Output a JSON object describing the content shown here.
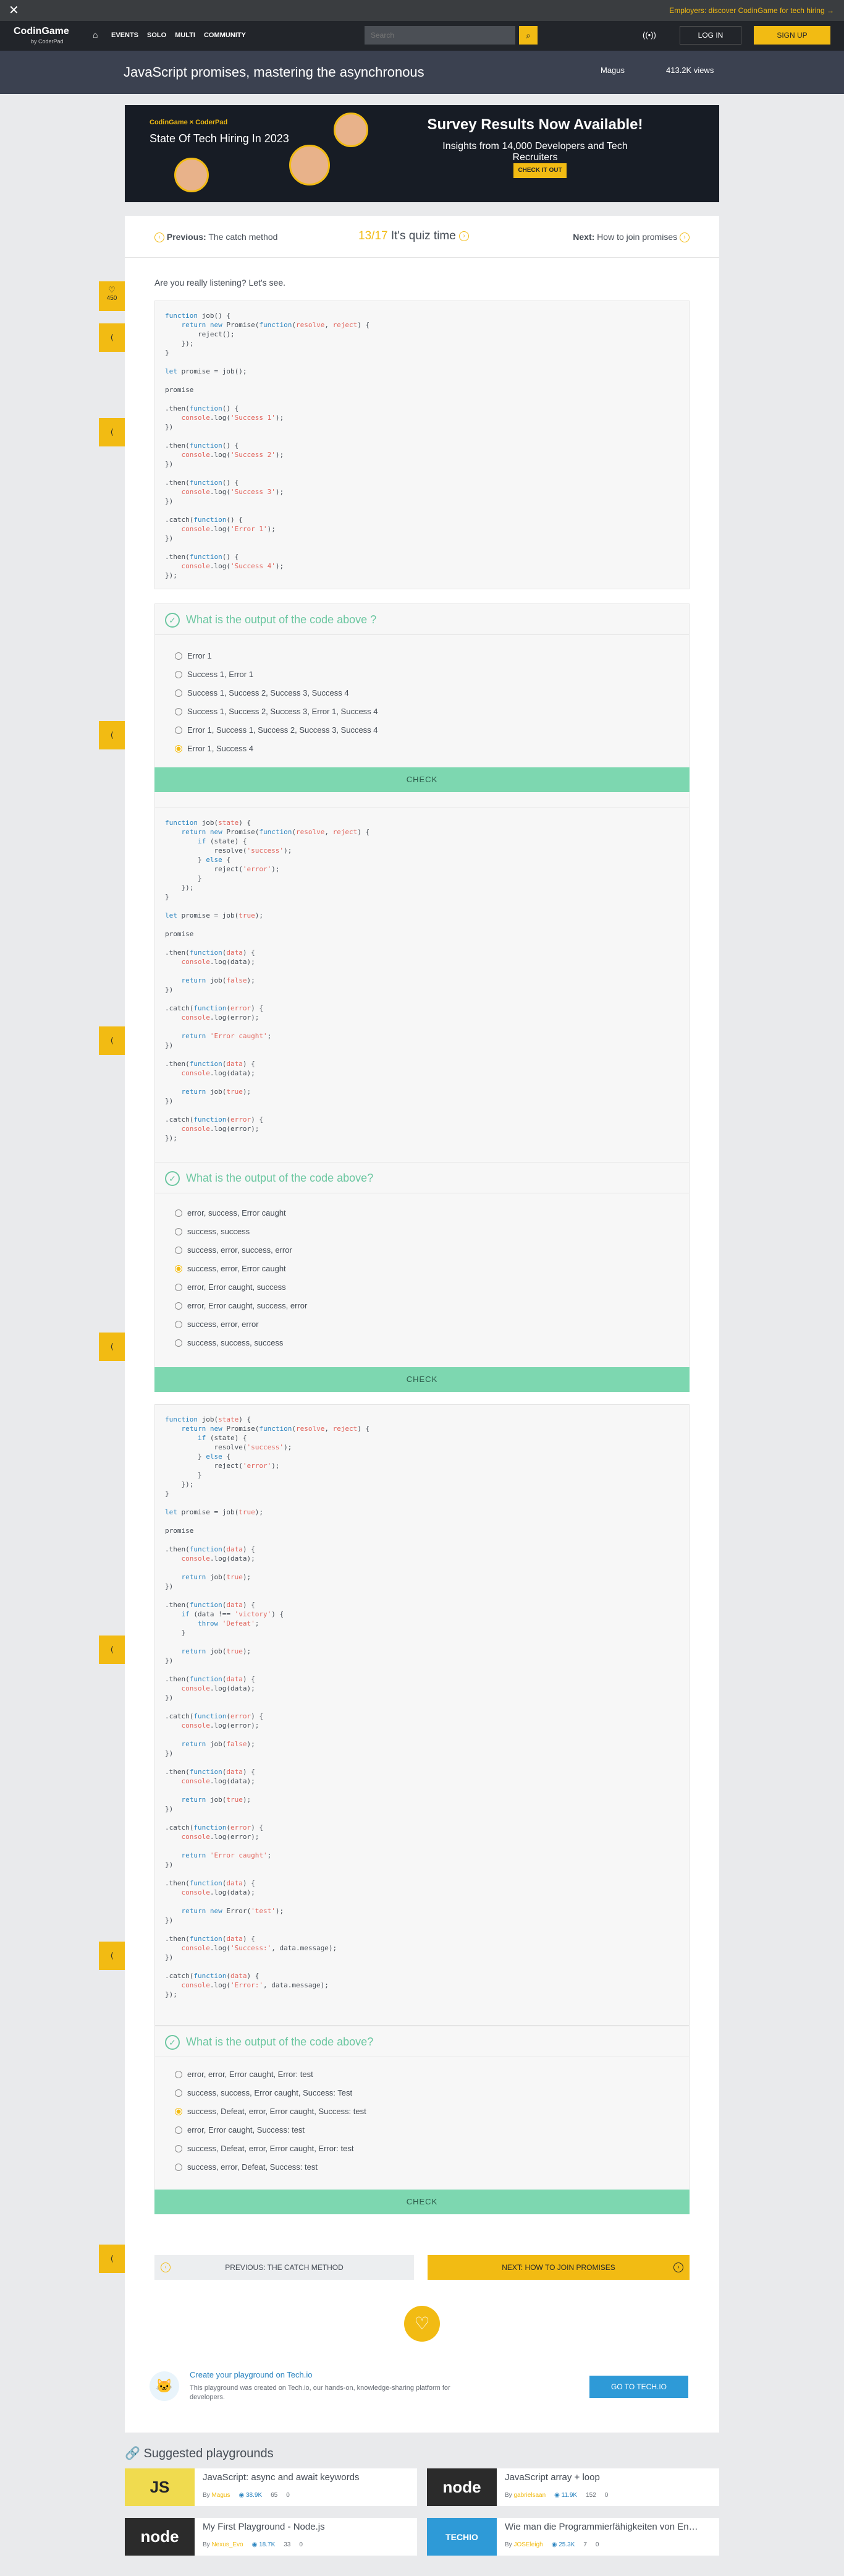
{
  "topbar": {
    "close": "✕",
    "promo": "Employers: discover CodinGame for tech hiring →"
  },
  "nav": {
    "logo": "CodinGame",
    "logo_by": "by CoderPad",
    "home": "⌂",
    "menu": [
      "EVENTS",
      "SOLO",
      "MULTI",
      "COMMUNITY"
    ],
    "search_placeholder": "Search",
    "search_icon": "⌕",
    "live_icon": "((•))",
    "login": "LOG IN",
    "signup": "SIGN UP"
  },
  "page_header": {
    "title": "JavaScript promises, mastering the asynchronous",
    "author": "Magus",
    "views": "413.2K views"
  },
  "banner": {
    "brand": "CodinGame × CoderPad",
    "sot": "State Of Tech Hiring In 2023",
    "headline": "Survey Results Now Available!",
    "subline": "Insights from 14,000 Developers and Tech Recruiters",
    "cta": "CHECK IT OUT"
  },
  "pager": {
    "prev_label": "Previous:",
    "prev_title": "The catch method",
    "current": "13/17",
    "current_title": "It's quiz time",
    "next_label": "Next:",
    "next_title": "How to join promises"
  },
  "sidebar": {
    "likes": "450",
    "heart_icon": "♡",
    "share_icon": "⟨"
  },
  "intro": "Are you really listening? Let's see.",
  "quizzes": [
    {
      "question": "What is the output of the code above ?",
      "options": [
        "Error 1",
        "Success 1, Error 1",
        "Success 1, Success 2, Success 3, Success 4",
        "Success 1, Success 2, Success 3, Error 1, Success 4",
        "Error 1, Success 1, Success 2, Success 3, Success 4",
        "Error 1, Success 4"
      ],
      "selected": 5,
      "check": "CHECK"
    },
    {
      "question": "What is the output of the code above?",
      "options": [
        "error, success, Error caught",
        "success, success",
        "success, error, success, error",
        "success, error, Error caught",
        "error, Error caught, success",
        "error, Error caught, success, error",
        "success, error, error",
        "success, success, success"
      ],
      "selected": 3,
      "check": "CHECK"
    },
    {
      "question": "What is the output of the code above?",
      "options": [
        "error, error, Error caught, Error: test",
        "success, success, Error caught, Success: Test",
        "success, Defeat, error, Error caught, Success: test",
        "error, Error caught, Success: test",
        "success, Defeat, error, Error caught, Error: test",
        "success, error, Defeat, Success: test"
      ],
      "selected": 2,
      "check": "CHECK"
    }
  ],
  "bottom_nav": {
    "prev": "PREVIOUS: THE CATCH METHOD",
    "next": "NEXT: HOW TO JOIN PROMISES",
    "prev_icon": "‹",
    "next_icon": "›"
  },
  "techio": {
    "title": "Create your playground on Tech.io",
    "desc": "This playground was created on Tech.io, our hands-on, knowledge-sharing platform for developers.",
    "button": "GO TO TECH.IO",
    "cat_icon": "tech-io-cat-icon"
  },
  "suggested": {
    "title": "Suggested playgrounds",
    "cards": [
      {
        "thumb": "JS",
        "title": "JavaScript: async and await keywords",
        "by": "By",
        "author": "Magus",
        "views": "38.9K",
        "likes": "65",
        "comments": "0"
      },
      {
        "thumb": "node",
        "title": "JavaScript array + loop",
        "by": "By",
        "author": "gabrielsaan",
        "views": "11.9K",
        "likes": "152",
        "comments": "0"
      },
      {
        "thumb": "node",
        "title": "My First Playground - Node.js",
        "by": "By",
        "author": "Nexus_Evo",
        "views": "18.7K",
        "likes": "33",
        "comments": "0"
      },
      {
        "thumb": "TECHIO",
        "title": "Wie man die Programmierfähigkeiten von En…",
        "by": "By",
        "author": "JOSEleigh",
        "views": "25.3K",
        "likes": "7",
        "comments": "0"
      }
    ]
  },
  "colors": {
    "accent": "#f2bb13",
    "quiz_green": "#6cc7a1",
    "check_bg": "#7dd7b0",
    "link_blue": "#2e86c1"
  }
}
